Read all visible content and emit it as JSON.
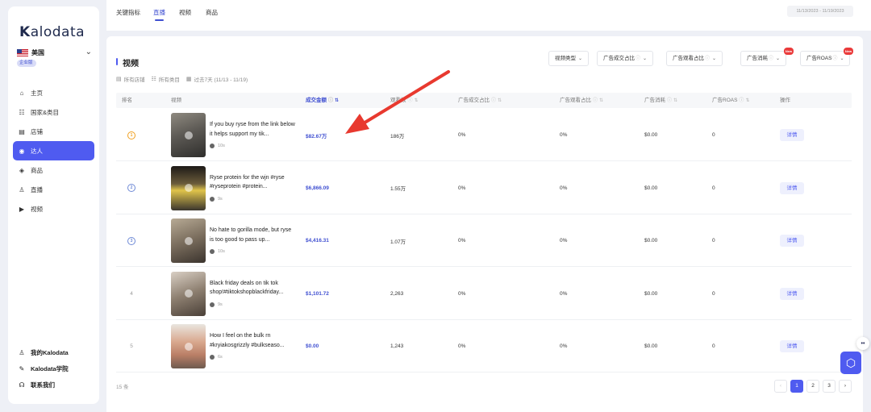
{
  "brand": {
    "logo_prefix": "K",
    "logo_rest": "alodata"
  },
  "region": {
    "country": "美国",
    "tier": "企业版"
  },
  "nav": {
    "items": [
      {
        "label": "主页",
        "icon": "home-icon",
        "glyph": "⌂"
      },
      {
        "label": "国家&类目",
        "icon": "category-icon",
        "glyph": "☷"
      },
      {
        "label": "店铺",
        "icon": "store-icon",
        "glyph": "▤"
      },
      {
        "label": "达人",
        "icon": "creator-icon",
        "glyph": "◉",
        "active": true
      },
      {
        "label": "商品",
        "icon": "product-icon",
        "glyph": "◈"
      },
      {
        "label": "直播",
        "icon": "live-icon",
        "glyph": "♙"
      },
      {
        "label": "视频",
        "icon": "video-icon",
        "glyph": "▶"
      }
    ],
    "bottom": [
      {
        "label": "我的Kalodata",
        "icon": "user-icon",
        "glyph": "♙"
      },
      {
        "label": "Kalodata学院",
        "icon": "academy-icon",
        "glyph": "✎"
      },
      {
        "label": "联系我们",
        "icon": "headset-icon",
        "glyph": "☊"
      }
    ]
  },
  "tabs": [
    {
      "label": "关键指标"
    },
    {
      "label": "直播",
      "active": true
    },
    {
      "label": "视频"
    },
    {
      "label": "商品"
    }
  ],
  "date_range": "11/13/2023 - 11/19/2023",
  "section": {
    "title": "视频",
    "filters": [
      "所有店铺",
      "所有类目",
      "过去7天 (11/13 - 11/19)"
    ]
  },
  "dropdowns": [
    {
      "label": "视频类型"
    },
    {
      "label": "广告成交占比"
    },
    {
      "label": "广告观看占比"
    },
    {
      "label": "广告消耗",
      "badge": "New"
    },
    {
      "label": "广告ROAS",
      "badge": "New"
    }
  ],
  "table": {
    "columns": [
      "排名",
      "视频",
      "成交金额",
      "观看数",
      "广告成交占比",
      "广告观看占比",
      "广告消耗",
      "广告ROAS",
      "操作"
    ],
    "sorted_column": "成交金额",
    "rows": [
      {
        "rank": "1",
        "title": "If you buy ryse from the link below it helps support my tik...",
        "duration": "10s",
        "amount": "$82.67万",
        "views": "186万",
        "ad_sales": "0%",
        "ad_views": "0%",
        "ad_spend": "$0.00",
        "roas": "0",
        "action": "详情"
      },
      {
        "rank": "2",
        "title": "Ryse protein for the wjn #ryse #ryseprotein #protein...",
        "duration": "9s",
        "amount": "$6,866.09",
        "views": "1.55万",
        "ad_sales": "0%",
        "ad_views": "0%",
        "ad_spend": "$0.00",
        "roas": "0",
        "action": "详情"
      },
      {
        "rank": "3",
        "title": "No hate to gorilla mode, but ryse is too good to pass up...",
        "duration": "10s",
        "amount": "$4,416.31",
        "views": "1.07万",
        "ad_sales": "0%",
        "ad_views": "0%",
        "ad_spend": "$0.00",
        "roas": "0",
        "action": "详情"
      },
      {
        "rank": "4",
        "title": "Black friday deals on tik tok shop!#tiktokshopblackfriday...",
        "duration": "9s",
        "amount": "$1,101.72",
        "views": "2,263",
        "ad_sales": "0%",
        "ad_views": "0%",
        "ad_spend": "$0.00",
        "roas": "0",
        "action": "详情"
      },
      {
        "rank": "5",
        "title": "How I feel on the bulk rn #kryiakosgrizzly #bulkseaso...",
        "duration": "6s",
        "amount": "$0.00",
        "views": "1,243",
        "ad_sales": "0%",
        "ad_views": "0%",
        "ad_spend": "$0.00",
        "roas": "0",
        "action": "详情"
      }
    ]
  },
  "footer": {
    "count": "15 条"
  },
  "pagination": {
    "prev": "‹",
    "pages": [
      "1",
      "2",
      "3"
    ],
    "current": "1",
    "next": "›"
  },
  "colors": {
    "accent": "#4f5bf0",
    "annotation_arrow": "#e8392f"
  }
}
